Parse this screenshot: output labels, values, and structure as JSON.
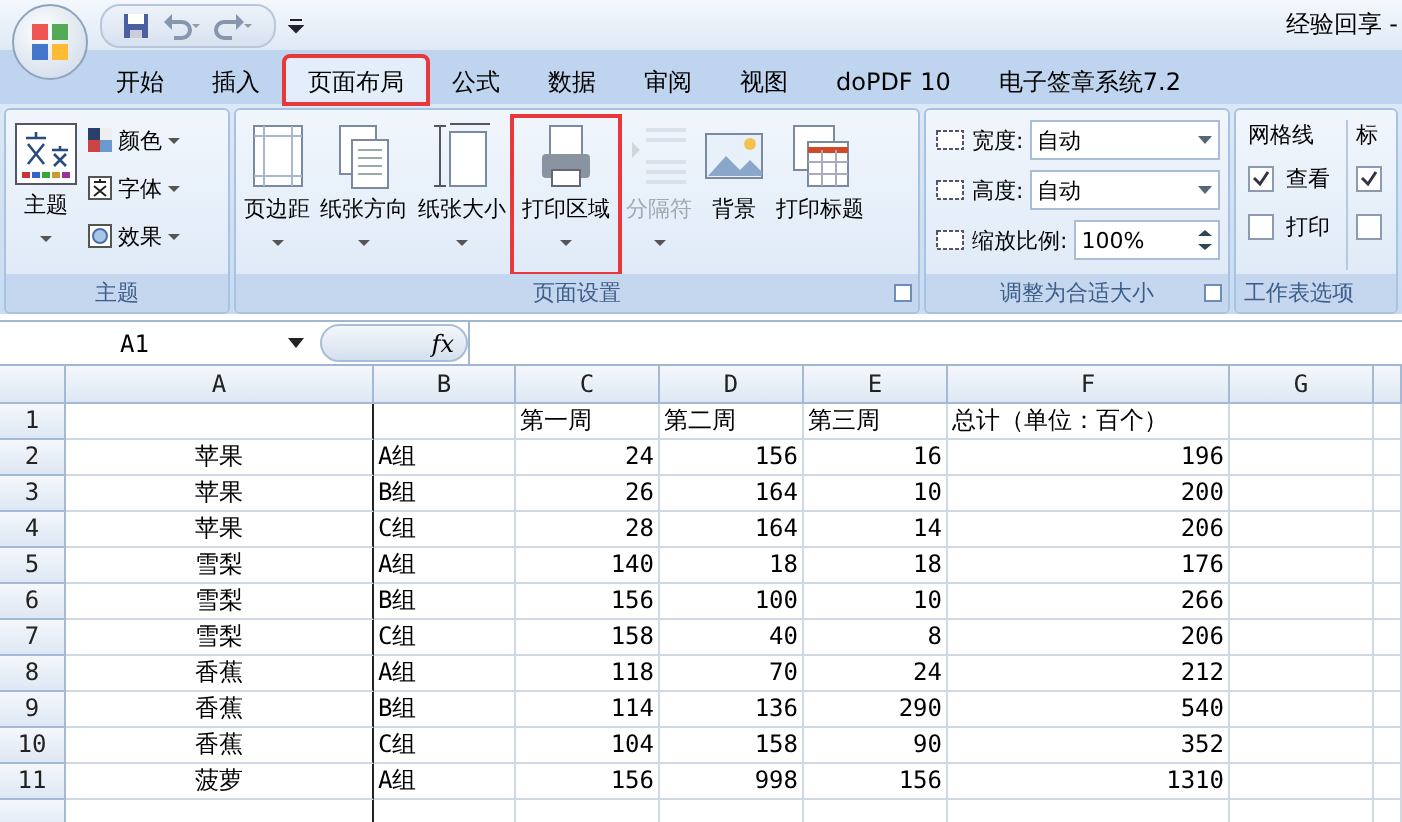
{
  "title_bar": {
    "title": "经验回享 -"
  },
  "tabs": [
    {
      "label": "开始",
      "selected": false,
      "highlighted": false
    },
    {
      "label": "插入",
      "selected": false,
      "highlighted": false
    },
    {
      "label": "页面布局",
      "selected": true,
      "highlighted": true
    },
    {
      "label": "公式",
      "selected": false,
      "highlighted": false
    },
    {
      "label": "数据",
      "selected": false,
      "highlighted": false
    },
    {
      "label": "审阅",
      "selected": false,
      "highlighted": false
    },
    {
      "label": "视图",
      "selected": false,
      "highlighted": false
    },
    {
      "label": "doPDF 10",
      "selected": false,
      "highlighted": false
    },
    {
      "label": "电子签章系统7.2",
      "selected": false,
      "highlighted": false
    }
  ],
  "ribbon_groups": [
    {
      "kind": "theme",
      "label": "主题",
      "launcher": false,
      "big_button": "主题",
      "small_buttons": [
        "颜色",
        "字体",
        "效果"
      ]
    },
    {
      "kind": "buttons",
      "label": "页面设置",
      "launcher": true,
      "buttons": [
        {
          "label": "页边距",
          "dropdown": true,
          "disabled": false,
          "highlighted": false
        },
        {
          "label": "纸张方向",
          "dropdown": true,
          "disabled": false,
          "highlighted": false
        },
        {
          "label": "纸张大小",
          "dropdown": true,
          "disabled": false,
          "highlighted": false
        },
        {
          "label": "打印区域",
          "dropdown": true,
          "disabled": false,
          "highlighted": true
        },
        {
          "label": "分隔符",
          "dropdown": true,
          "disabled": true,
          "highlighted": false
        },
        {
          "label": "背景",
          "dropdown": false,
          "disabled": false,
          "highlighted": false
        },
        {
          "label": "打印标题",
          "dropdown": false,
          "disabled": false,
          "highlighted": false
        }
      ]
    },
    {
      "kind": "scale",
      "label": "调整为合适大小",
      "launcher": true,
      "fields": [
        {
          "label": "宽度:",
          "value": "自动",
          "kind": "dropdown"
        },
        {
          "label": "高度:",
          "value": "自动",
          "kind": "dropdown"
        },
        {
          "label": "缩放比例:",
          "value": "100%",
          "kind": "spinner"
        }
      ]
    },
    {
      "kind": "sheet_options",
      "label": "工作表选项",
      "launcher": false,
      "columns": [
        {
          "title": "网格线",
          "options": [
            {
              "label": "查看",
              "checked": true
            },
            {
              "label": "打印",
              "checked": false
            }
          ]
        },
        {
          "title": "标",
          "options": [
            {
              "checked": true
            },
            {
              "checked": false
            }
          ]
        }
      ]
    }
  ],
  "formula_bar": {
    "name_box": "A1",
    "fx": "fx"
  },
  "sheet": {
    "columns": [
      "A",
      "B",
      "C",
      "D",
      "E",
      "F",
      "G"
    ],
    "rows": [
      {
        "number": "1",
        "cells": [
          "",
          "",
          "第一周",
          "第二周",
          "第三周",
          "总计（单位：百个）",
          ""
        ]
      },
      {
        "number": "2",
        "cells": [
          "苹果",
          "A组",
          "24",
          "156",
          "16",
          "196",
          ""
        ]
      },
      {
        "number": "3",
        "cells": [
          "苹果",
          "B组",
          "26",
          "164",
          "10",
          "200",
          ""
        ]
      },
      {
        "number": "4",
        "cells": [
          "苹果",
          "C组",
          "28",
          "164",
          "14",
          "206",
          ""
        ]
      },
      {
        "number": "5",
        "cells": [
          "雪梨",
          "A组",
          "140",
          "18",
          "18",
          "176",
          ""
        ]
      },
      {
        "number": "6",
        "cells": [
          "雪梨",
          "B组",
          "156",
          "100",
          "10",
          "266",
          ""
        ]
      },
      {
        "number": "7",
        "cells": [
          "雪梨",
          "C组",
          "158",
          "40",
          "8",
          "206",
          ""
        ]
      },
      {
        "number": "8",
        "cells": [
          "香蕉",
          "A组",
          "118",
          "70",
          "24",
          "212",
          ""
        ]
      },
      {
        "number": "9",
        "cells": [
          "香蕉",
          "B组",
          "114",
          "136",
          "290",
          "540",
          ""
        ]
      },
      {
        "number": "10",
        "cells": [
          "香蕉",
          "C组",
          "104",
          "158",
          "90",
          "352",
          ""
        ]
      },
      {
        "number": "11",
        "cells": [
          "菠萝",
          "A组",
          "156",
          "998",
          "156",
          "1310",
          ""
        ]
      },
      {
        "number": "",
        "cells": [
          "",
          "",
          "",
          "",
          "",
          "",
          ""
        ]
      }
    ]
  }
}
